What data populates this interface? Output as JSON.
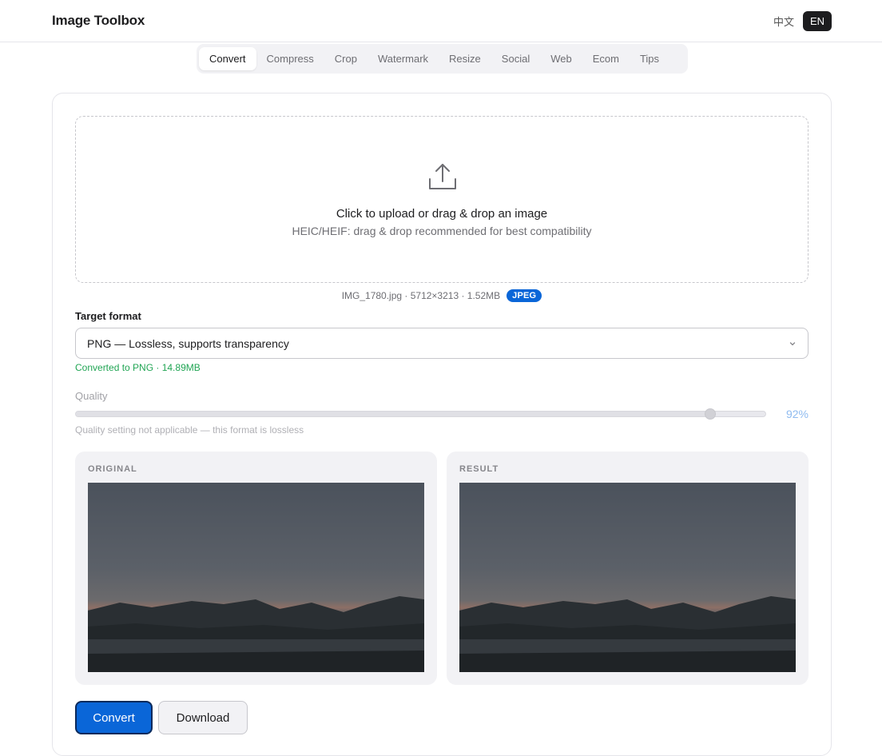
{
  "header": {
    "title": "Image Toolbox",
    "lang_zh": "中文",
    "lang_en": "EN",
    "active_lang": "EN"
  },
  "tabs": [
    {
      "label": "Convert",
      "active": true
    },
    {
      "label": "Compress",
      "active": false
    },
    {
      "label": "Crop",
      "active": false
    },
    {
      "label": "Watermark",
      "active": false
    },
    {
      "label": "Resize",
      "active": false
    },
    {
      "label": "Social",
      "active": false
    },
    {
      "label": "Web",
      "active": false
    },
    {
      "label": "Ecom",
      "active": false
    },
    {
      "label": "Tips",
      "active": false
    }
  ],
  "upload": {
    "icon": "upload-icon",
    "title": "Click to upload or drag & drop an image",
    "hint": "HEIC/HEIF: drag & drop recommended for best compatibility"
  },
  "file": {
    "info": "IMG_1780.jpg · 5712×3213 · 1.52MB",
    "format_badge": "JPEG"
  },
  "target_format": {
    "label": "Target format",
    "selected": "PNG — Lossless, supports transparency",
    "status": "Converted to PNG · 14.89MB"
  },
  "quality": {
    "label": "Quality",
    "value": 92,
    "value_text": "92%",
    "note": "Quality setting not applicable — this format is lossless"
  },
  "previews": {
    "original_label": "ORIGINAL",
    "result_label": "RESULT"
  },
  "actions": {
    "convert_label": "Convert",
    "download_label": "Download"
  },
  "colors": {
    "accent": "#0a66d8",
    "success": "#21a554",
    "dark": "#1d1d1f"
  }
}
